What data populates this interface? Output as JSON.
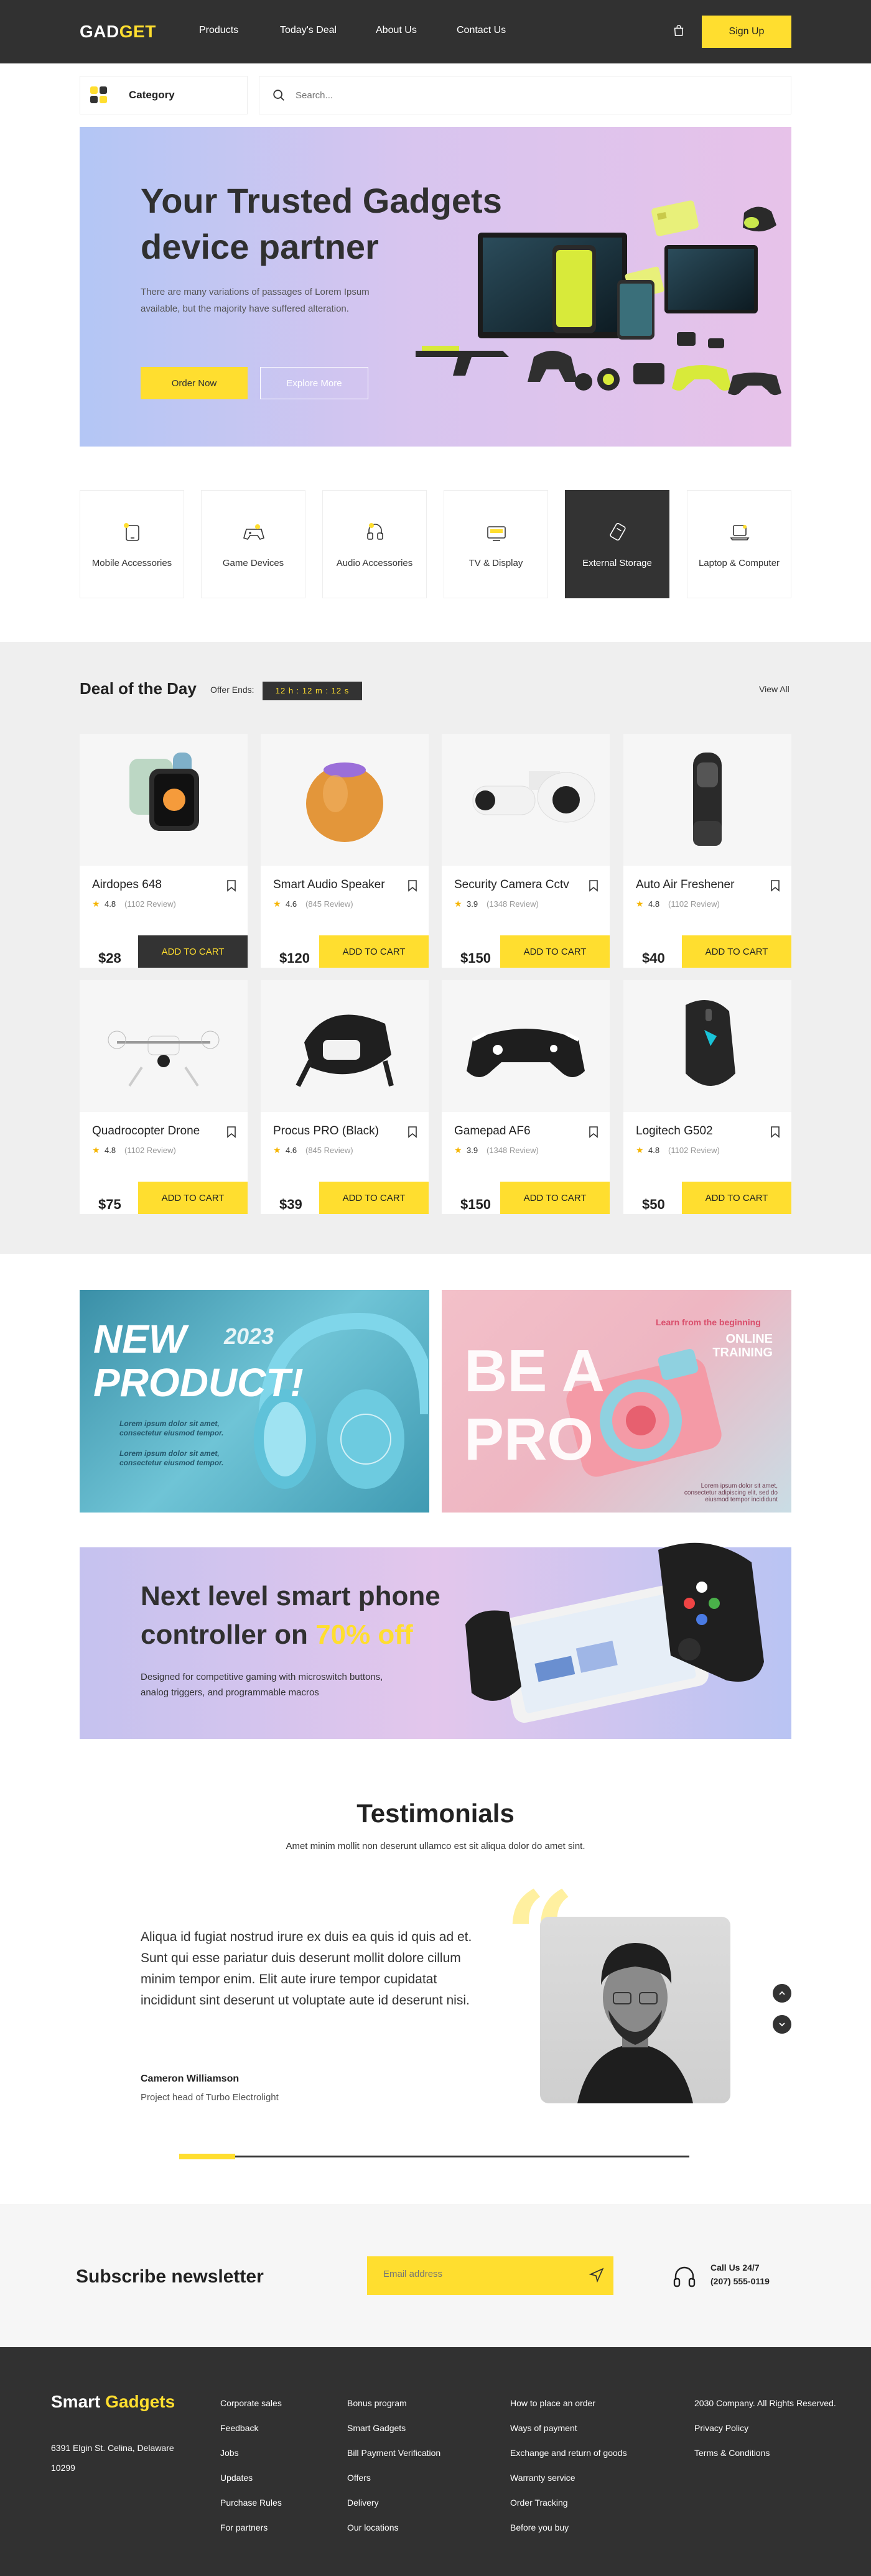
{
  "nav": {
    "logo_part1": "GAD",
    "logo_part2": "GET",
    "links": [
      "Products",
      "Today's Deal",
      "About Us",
      "Contact Us"
    ],
    "signup": "Sign Up"
  },
  "category_bar": {
    "label": "Category",
    "search_placeholder": "Search..."
  },
  "hero": {
    "title": "Your Trusted Gadgets device partner",
    "description": "There are many variations of passages of Lorem Ipsum available, but the majority have suffered alteration.",
    "primary_button": "Order Now",
    "secondary_button": "Explore More"
  },
  "categories": [
    {
      "label": "Mobile Accessories",
      "icon": "mobile-icon",
      "active": false
    },
    {
      "label": "Game Devices",
      "icon": "gamepad-icon",
      "active": false
    },
    {
      "label": "Audio Accessories",
      "icon": "headphones-icon",
      "active": false
    },
    {
      "label": "TV & Display",
      "icon": "tv-icon",
      "active": false
    },
    {
      "label": "External Storage",
      "icon": "storage-icon",
      "active": true
    },
    {
      "label": "Laptop & Computer",
      "icon": "laptop-icon",
      "active": false
    }
  ],
  "deal": {
    "title": "Deal of the Day",
    "offer_label": "Offer Ends:",
    "timer": "12 h  :  12 m  :  12 s",
    "view_all": "View All",
    "button_label": "ADD TO CART",
    "products": [
      {
        "name": "Airdopes 648",
        "rating": "4.8",
        "reviews": "(1102 Review)",
        "price": "$28",
        "dark": true
      },
      {
        "name": "Smart Audio Speaker",
        "rating": "4.6",
        "reviews": "(845 Review)",
        "price": "$120",
        "dark": false
      },
      {
        "name": "Security Camera Cctv",
        "rating": "3.9",
        "reviews": "(1348 Review)",
        "price": "$150",
        "dark": false
      },
      {
        "name": "Auto Air Freshener",
        "rating": "4.8",
        "reviews": "(1102 Review)",
        "price": "$40",
        "dark": false
      },
      {
        "name": "Quadrocopter Drone",
        "rating": "4.8",
        "reviews": "(1102 Review)",
        "price": "$75",
        "dark": false
      },
      {
        "name": "Procus PRO (Black)",
        "rating": "4.6",
        "reviews": "(845 Review)",
        "price": "$39",
        "dark": false
      },
      {
        "name": "Gamepad AF6",
        "rating": "3.9",
        "reviews": "(1348 Review)",
        "price": "$150",
        "dark": false
      },
      {
        "name": "Logitech G502",
        "rating": "4.8",
        "reviews": "(1102 Review)",
        "price": "$50",
        "dark": false
      }
    ]
  },
  "banner_new": {
    "headline_1": "NEW",
    "headline_2": "PRODUCT!",
    "year": "2023",
    "text_1": "Lorem ipsum dolor sit amet, consectetur eiusmod tempor.",
    "text_2": "Lorem ipsum dolor sit amet, consectetur eiusmod tempor."
  },
  "banner_pro": {
    "headline_1": "BE A",
    "headline_2": "PRO",
    "learn": "Learn from the beginning",
    "tag_1": "ONLINE",
    "tag_2": "TRAINING",
    "small": "Lorem ipsum dolor sit amet, consectetur adipiscing elit, sed do eiusmod tempor incididunt"
  },
  "controller_banner": {
    "title_1": "Next level smart phone controller on ",
    "highlight": "70% off",
    "description": "Designed for competitive gaming with microswitch buttons, analog triggers, and programmable macros"
  },
  "testimonials": {
    "title": "Testimonials",
    "subtitle": "Amet minim mollit non deserunt ullamco est sit aliqua dolor do amet sint.",
    "quote": "Aliqua id fugiat nostrud irure ex duis ea quis id quis ad et. Sunt qui esse pariatur duis deserunt mollit dolore cillum minim tempor enim. Elit aute irure tempor cupidatat incididunt sint deserunt ut voluptate aute id deserunt nisi.",
    "name": "Cameron Williamson",
    "role": "Project head of Turbo Electrolight",
    "progress": 0.11
  },
  "newsletter": {
    "title": "Subscribe newsletter",
    "email_placeholder": "Email address",
    "call_label": "Call Us 24/7",
    "phone": "(207) 555-0119"
  },
  "footer": {
    "brand_1": "Smart ",
    "brand_2": "Gadgets",
    "address": "6391 Elgin St. Celina, Delaware 10299",
    "col1": [
      "Corporate sales",
      "Feedback",
      "Jobs",
      "Updates",
      "Purchase Rules",
      "For partners"
    ],
    "col2": [
      "Bonus program",
      "Smart Gadgets",
      "Bill Payment Verification",
      "Offers",
      "Delivery",
      "Our locations"
    ],
    "col3": [
      "How to place an order",
      "Ways of payment",
      "Exchange and return of goods",
      "Warranty service",
      "Order Tracking",
      "Before you buy"
    ],
    "col4": [
      "2030 Company. All Rights Reserved.",
      "Privacy Policy",
      "Terms & Conditions"
    ]
  },
  "colors": {
    "accent": "#FFDE2F",
    "dark": "#313131",
    "light_bg": "#efefef"
  }
}
